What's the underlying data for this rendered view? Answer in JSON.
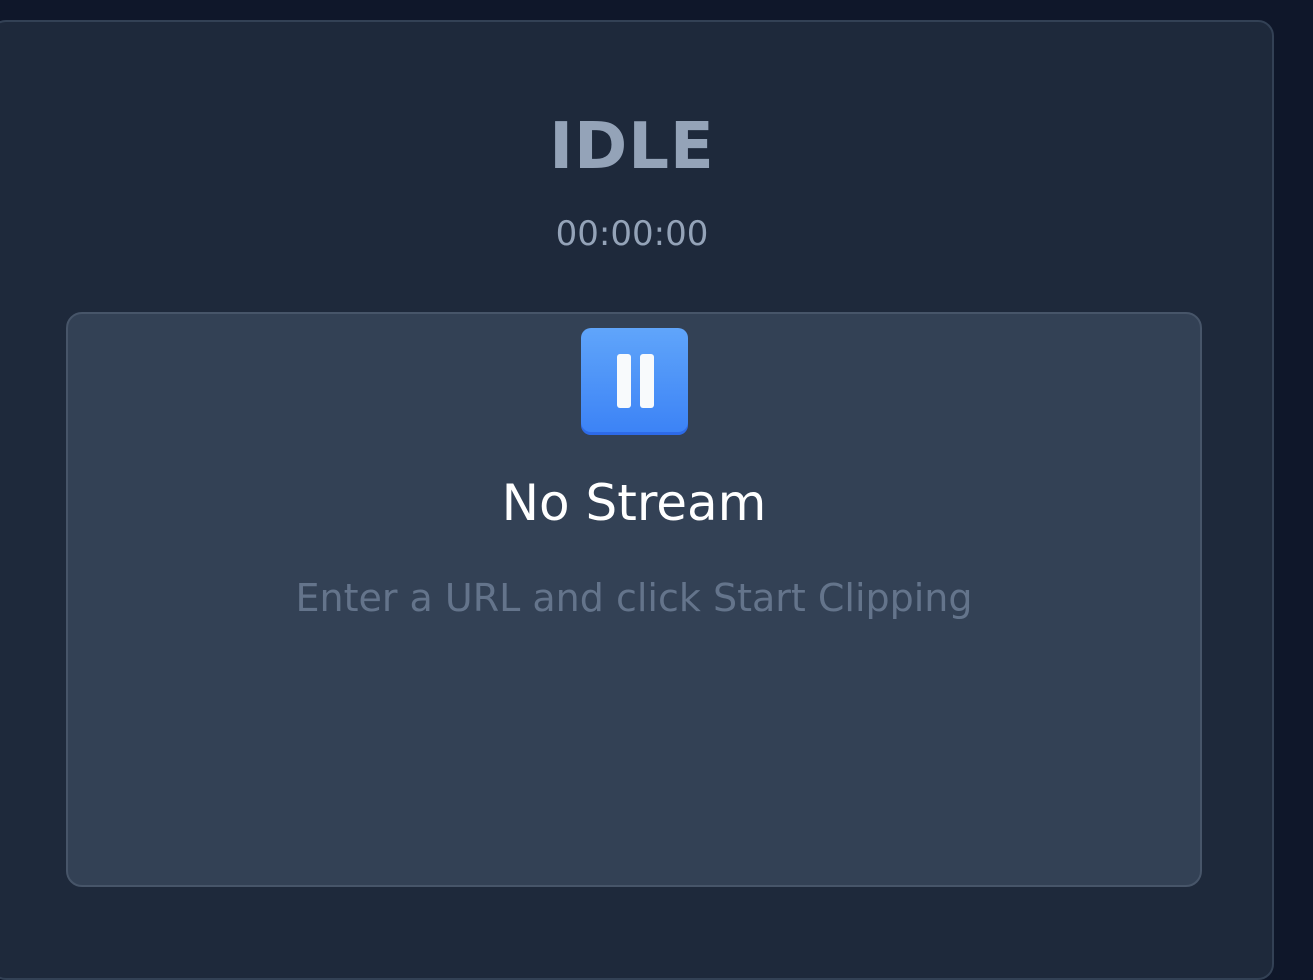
{
  "status": {
    "label": "IDLE",
    "elapsed": "00:00:00"
  },
  "preview": {
    "icon": "pause-icon",
    "title": "No Stream",
    "hint": "Enter a URL and click Start Clipping"
  },
  "colors": {
    "background": "#0f172a",
    "panel": "#1e293b",
    "preview": "#334155",
    "accent": "#3b82f6",
    "muted_text": "#94a3b8",
    "hint_text": "#64748b"
  }
}
